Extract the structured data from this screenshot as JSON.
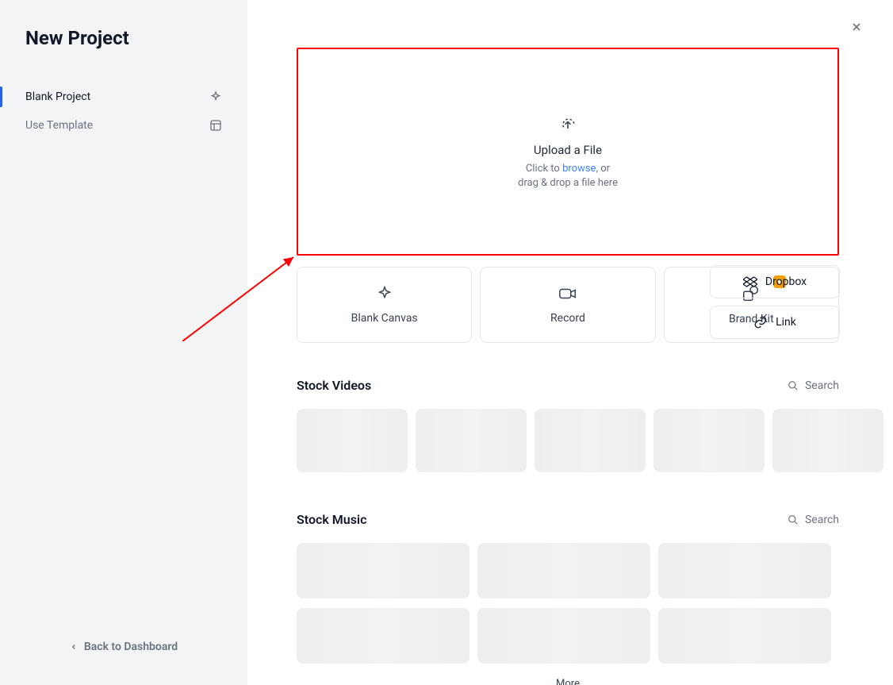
{
  "sidebar": {
    "title": "New Project",
    "items": [
      {
        "label": "Blank Project",
        "active": true
      },
      {
        "label": "Use Template",
        "active": false
      }
    ],
    "back_label": "Back to Dashboard"
  },
  "upload": {
    "title": "Upload a File",
    "sub_prefix": "Click to ",
    "sub_link": "browse",
    "sub_suffix": ", or",
    "sub_line2": "drag & drop a file here"
  },
  "actions": {
    "blank_canvas": "Blank Canvas",
    "record": "Record",
    "brand_kit": "Brand Kit",
    "dropbox": "Dropbox",
    "link": "Link"
  },
  "sections": {
    "stock_videos": {
      "title": "Stock Videos",
      "search": "Search"
    },
    "stock_music": {
      "title": "Stock Music",
      "search": "Search",
      "more": "More"
    }
  }
}
